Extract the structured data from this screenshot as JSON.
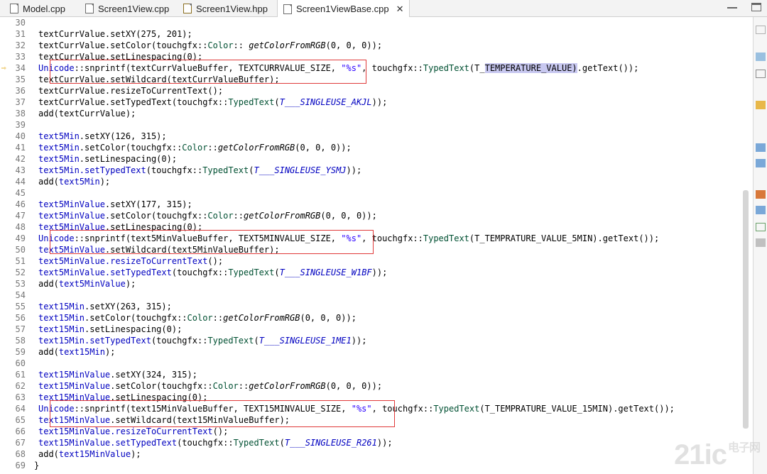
{
  "tabs": [
    {
      "label": "Model.cpp",
      "icon": "cpp-file-icon",
      "active": false
    },
    {
      "label": "Screen1View.cpp",
      "icon": "cpp-file-icon",
      "active": false
    },
    {
      "label": "Screen1View.hpp",
      "icon": "hpp-file-icon",
      "active": false
    },
    {
      "label": "Screen1ViewBase.cpp",
      "icon": "cpp-file-icon",
      "active": true
    }
  ],
  "close_glyph": "✕",
  "arrow_glyph": "⇨",
  "watermark": {
    "main": "21ic",
    "sub": "电子网"
  },
  "lines": [
    {
      "n": "30",
      "segs": []
    },
    {
      "n": "31",
      "segs": [
        [
          "",
          "textCurrValue.setXY(275, 201);"
        ]
      ]
    },
    {
      "n": "32",
      "segs": [
        [
          "",
          "textCurrValue.setColor(touchgfx::"
        ],
        [
          "cls",
          "Color"
        ],
        [
          "",
          ":: "
        ],
        [
          "fn",
          "getColorFromRGB"
        ],
        [
          "",
          "(0, 0, 0));"
        ]
      ]
    },
    {
      "n": "33",
      "segs": [
        [
          "",
          "textCurrValue.setLinespacing(0);"
        ]
      ]
    },
    {
      "n": "34",
      "arrow": true,
      "segs": [
        [
          "field",
          "Unicode"
        ],
        [
          "",
          "::snprintf(textCurrValueBuffer, TEXTCURRVALUE_SIZE, "
        ],
        [
          "str",
          "\"%s\""
        ],
        [
          "",
          ", touchgfx::"
        ],
        [
          "cls",
          "TypedText"
        ],
        [
          "",
          "(T_"
        ],
        [
          "hl",
          "TEMPERATURE_VALUE)"
        ],
        [
          "",
          ".getText());"
        ]
      ]
    },
    {
      "n": "35",
      "segs": [
        [
          "",
          "textCurrValue.setWildcard(textCurrValueBuffer);"
        ]
      ]
    },
    {
      "n": "36",
      "segs": [
        [
          "",
          "textCurrValue.resizeToCurrentText();"
        ]
      ]
    },
    {
      "n": "37",
      "segs": [
        [
          "",
          "textCurrValue.setTypedText(touchgfx::"
        ],
        [
          "cls",
          "TypedText"
        ],
        [
          "",
          "("
        ],
        [
          "enumv",
          "T___SINGLEUSE_AKJL"
        ],
        [
          "",
          "));"
        ]
      ]
    },
    {
      "n": "38",
      "segs": [
        [
          "",
          "add(textCurrValue);"
        ]
      ]
    },
    {
      "n": "39",
      "segs": []
    },
    {
      "n": "40",
      "segs": [
        [
          "field",
          "text5Min"
        ],
        [
          "",
          ".setXY(126, 315);"
        ]
      ]
    },
    {
      "n": "41",
      "segs": [
        [
          "field",
          "text5Min"
        ],
        [
          "",
          ".setColor(touchgfx::"
        ],
        [
          "cls",
          "Color"
        ],
        [
          "",
          "::"
        ],
        [
          "fn",
          "getColorFromRGB"
        ],
        [
          "",
          "(0, 0, 0));"
        ]
      ]
    },
    {
      "n": "42",
      "segs": [
        [
          "field",
          "text5Min"
        ],
        [
          "",
          ".setLinespacing(0);"
        ]
      ]
    },
    {
      "n": "43",
      "segs": [
        [
          "field",
          "text5Min"
        ],
        [
          "field",
          ".setTypedText"
        ],
        [
          "",
          "(touchgfx::"
        ],
        [
          "cls",
          "TypedText"
        ],
        [
          "",
          "("
        ],
        [
          "enumv",
          "T___SINGLEUSE_YSMJ"
        ],
        [
          "",
          "));"
        ]
      ]
    },
    {
      "n": "44",
      "segs": [
        [
          "",
          "add("
        ],
        [
          "field",
          "text5Min"
        ],
        [
          "",
          ");"
        ]
      ]
    },
    {
      "n": "45",
      "segs": []
    },
    {
      "n": "46",
      "segs": [
        [
          "field",
          "text5MinValue"
        ],
        [
          "",
          ".setXY(177, 315);"
        ]
      ]
    },
    {
      "n": "47",
      "segs": [
        [
          "field",
          "text5MinValue"
        ],
        [
          "",
          ".setColor(touchgfx::"
        ],
        [
          "cls",
          "Color"
        ],
        [
          "",
          "::"
        ],
        [
          "fn",
          "getColorFromRGB"
        ],
        [
          "",
          "(0, 0, 0));"
        ]
      ]
    },
    {
      "n": "48",
      "segs": [
        [
          "field",
          "text5MinValue"
        ],
        [
          "",
          ".setLinespacing(0);"
        ]
      ]
    },
    {
      "n": "49",
      "segs": [
        [
          "field",
          "Unicode"
        ],
        [
          "",
          "::snprintf(text5MinValueBuffer, TEXT5MINVALUE_SIZE, "
        ],
        [
          "str",
          "\"%s\""
        ],
        [
          "",
          ", touchgfx::"
        ],
        [
          "cls",
          "TypedText"
        ],
        [
          "",
          "(T_TEMPRATURE_VALUE_5MIN).getText());"
        ]
      ]
    },
    {
      "n": "50",
      "segs": [
        [
          "field",
          "text5MinValue"
        ],
        [
          "",
          ".setWildcard(text5MinValueBuffer);"
        ]
      ]
    },
    {
      "n": "51",
      "segs": [
        [
          "field",
          "text5MinValue.resizeToCurrentText"
        ],
        [
          "",
          "();"
        ]
      ]
    },
    {
      "n": "52",
      "segs": [
        [
          "field",
          "text5MinValue.setTypedText"
        ],
        [
          "",
          "(touchgfx::"
        ],
        [
          "cls",
          "TypedText"
        ],
        [
          "",
          "("
        ],
        [
          "enumv",
          "T___SINGLEUSE_W1BF"
        ],
        [
          "",
          "));"
        ]
      ]
    },
    {
      "n": "53",
      "segs": [
        [
          "",
          "add("
        ],
        [
          "field",
          "text5MinValue"
        ],
        [
          "",
          ");"
        ]
      ]
    },
    {
      "n": "54",
      "segs": []
    },
    {
      "n": "55",
      "segs": [
        [
          "field",
          "text15Min"
        ],
        [
          "",
          ".setXY(263, 315);"
        ]
      ]
    },
    {
      "n": "56",
      "segs": [
        [
          "field",
          "text15Min"
        ],
        [
          "",
          ".setColor(touchgfx::"
        ],
        [
          "cls",
          "Color"
        ],
        [
          "",
          "::"
        ],
        [
          "fn",
          "getColorFromRGB"
        ],
        [
          "",
          "(0, 0, 0));"
        ]
      ]
    },
    {
      "n": "57",
      "segs": [
        [
          "field",
          "text15Min"
        ],
        [
          "",
          ".setLinespacing(0);"
        ]
      ]
    },
    {
      "n": "58",
      "segs": [
        [
          "field",
          "text15Min.setTypedText"
        ],
        [
          "",
          "(touchgfx::"
        ],
        [
          "cls",
          "TypedText"
        ],
        [
          "",
          "("
        ],
        [
          "enumv",
          "T___SINGLEUSE_1ME1"
        ],
        [
          "",
          "));"
        ]
      ]
    },
    {
      "n": "59",
      "segs": [
        [
          "",
          "add("
        ],
        [
          "field",
          "text15Min"
        ],
        [
          "",
          ");"
        ]
      ]
    },
    {
      "n": "60",
      "segs": []
    },
    {
      "n": "61",
      "segs": [
        [
          "field",
          "text15MinValue"
        ],
        [
          "",
          ".setXY(324, 315);"
        ]
      ]
    },
    {
      "n": "62",
      "segs": [
        [
          "field",
          "text15MinValue"
        ],
        [
          "",
          ".setColor(touchgfx::"
        ],
        [
          "cls",
          "Color"
        ],
        [
          "",
          "::"
        ],
        [
          "fn",
          "getColorFromRGB"
        ],
        [
          "",
          "(0, 0, 0));"
        ]
      ]
    },
    {
      "n": "63",
      "segs": [
        [
          "field",
          "text15MinValue"
        ],
        [
          "",
          ".setLinespacing(0);"
        ]
      ]
    },
    {
      "n": "64",
      "segs": [
        [
          "field",
          "Unicode"
        ],
        [
          "",
          "::snprintf(text15MinValueBuffer, TEXT15MINVALUE_SIZE, "
        ],
        [
          "str",
          "\"%s\""
        ],
        [
          "",
          ", touchgfx::"
        ],
        [
          "cls",
          "TypedText"
        ],
        [
          "",
          "(T_TEMPRATURE_VALUE_15MIN).getText());"
        ]
      ]
    },
    {
      "n": "65",
      "segs": [
        [
          "field",
          "text15MinValue"
        ],
        [
          "",
          ".setWildcard(text15MinValueBuffer);"
        ]
      ]
    },
    {
      "n": "66",
      "segs": [
        [
          "field",
          "text15MinValue.resizeToCurrentText"
        ],
        [
          "",
          "();"
        ]
      ]
    },
    {
      "n": "67",
      "segs": [
        [
          "field",
          "text15MinValue.setTypedText"
        ],
        [
          "",
          "(touchgfx::"
        ],
        [
          "cls",
          "TypedText"
        ],
        [
          "",
          "("
        ],
        [
          "enumv",
          "T___SINGLEUSE_R261"
        ],
        [
          "",
          "));"
        ]
      ]
    },
    {
      "n": "68",
      "segs": [
        [
          "",
          "add("
        ],
        [
          "field",
          "text15MinValue"
        ],
        [
          "",
          ");"
        ]
      ]
    },
    {
      "n": "69",
      "brace": true,
      "segs": [
        [
          "",
          "}"
        ]
      ]
    }
  ]
}
